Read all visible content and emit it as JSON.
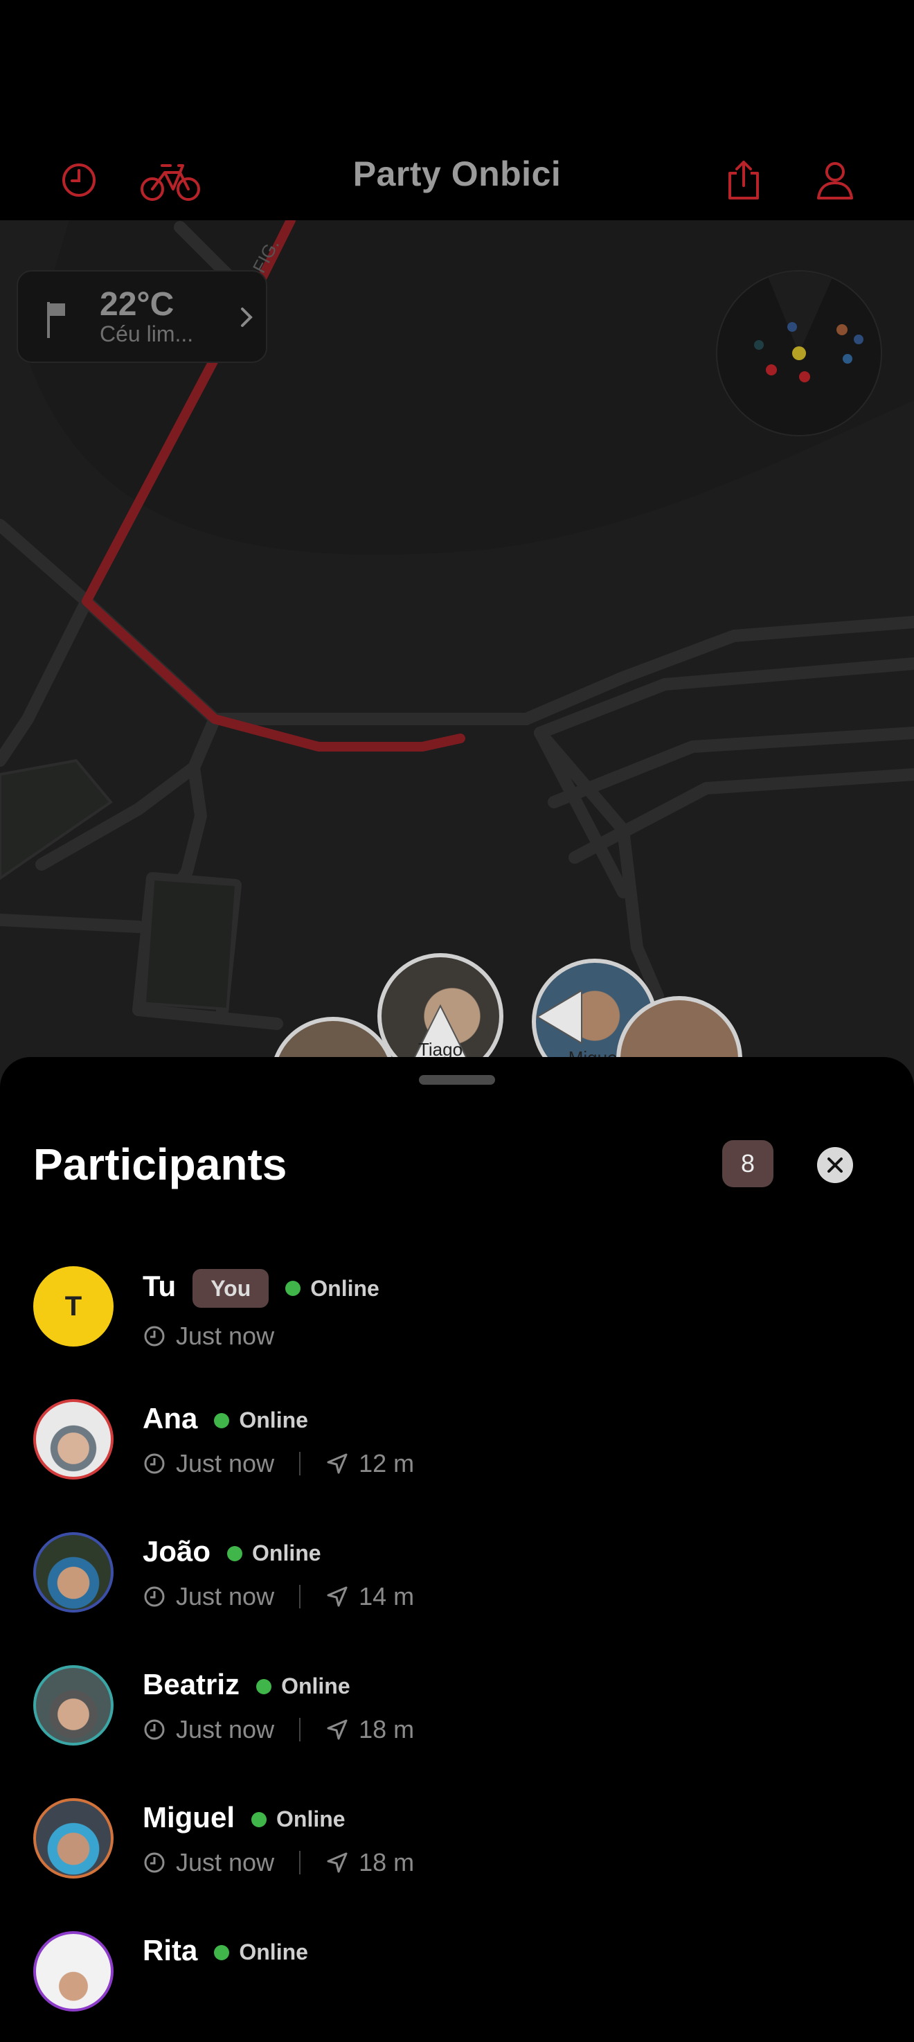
{
  "header": {
    "title": "Party Onbici",
    "left_icons": [
      "history-icon",
      "bike-icon"
    ],
    "right_icons": [
      "share-icon",
      "profile-icon"
    ]
  },
  "weather": {
    "temperature": "22°C",
    "description": "Céu lim..."
  },
  "map": {
    "markers": [
      {
        "label": "Tiago"
      },
      {
        "label": "Miguel"
      }
    ]
  },
  "sheet": {
    "title": "Participants",
    "count": "8",
    "participants": [
      {
        "name": "Tu",
        "badge": "You",
        "status": "Online",
        "time": "Just now",
        "distance": "",
        "avatar_letter": "T",
        "ring_color": "#f5cc12"
      },
      {
        "name": "Ana",
        "badge": "",
        "status": "Online",
        "time": "Just now",
        "distance": "12 m",
        "ring_color": "#d23c3c"
      },
      {
        "name": "João",
        "badge": "",
        "status": "Online",
        "time": "Just now",
        "distance": "14 m",
        "ring_color": "#3b4ea8"
      },
      {
        "name": "Beatriz",
        "badge": "",
        "status": "Online",
        "time": "Just now",
        "distance": "18 m",
        "ring_color": "#3aa6a6"
      },
      {
        "name": "Miguel",
        "badge": "",
        "status": "Online",
        "time": "Just now",
        "distance": "18 m",
        "ring_color": "#d2733c"
      },
      {
        "name": "Rita",
        "badge": "",
        "status": "Online",
        "time": "",
        "distance": "",
        "ring_color": "#8c3cc8"
      }
    ]
  },
  "colors": {
    "accent": "#c0282d",
    "online": "#3fb54a",
    "badge_bg": "#5a4242"
  }
}
